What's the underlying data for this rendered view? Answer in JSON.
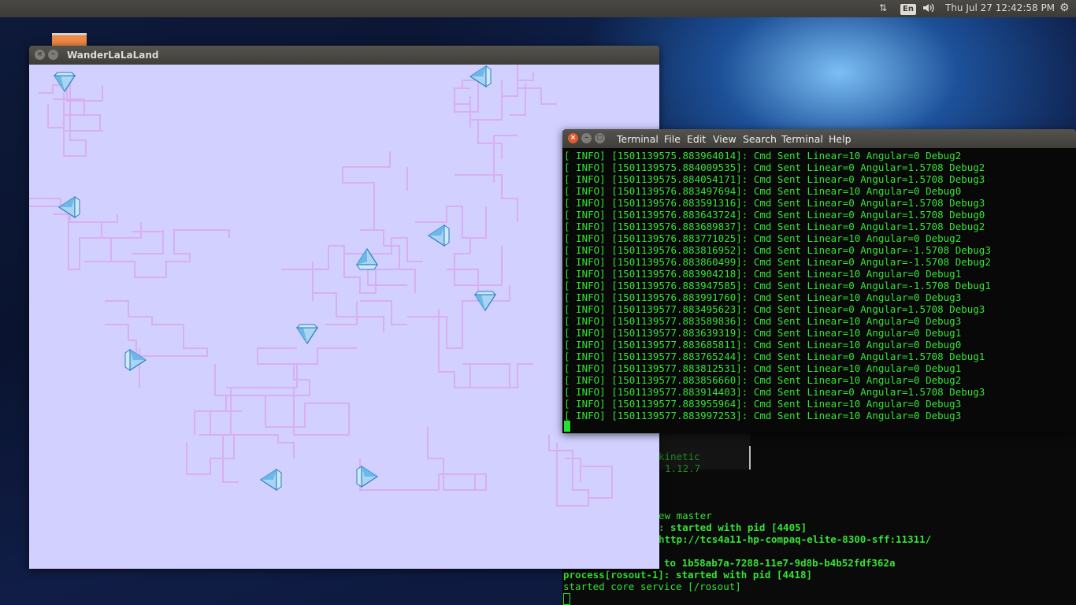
{
  "topbar": {
    "keyboard_layout": "En",
    "clock": "Thu Jul 27 12:42:58 PM",
    "icons": [
      "network-arrows-icon",
      "volume-icon",
      "settings-gear-icon"
    ]
  },
  "wander_window": {
    "title": "WanderLaLaLand",
    "trail_color": "#d9aef2",
    "canvas_color": "#d1d0ff",
    "robot_icon": "blue-diamond-robot-icon"
  },
  "terminal": {
    "menu": [
      "Terminal",
      "File",
      "Edit",
      "View",
      "Search",
      "Terminal",
      "Help"
    ],
    "lines": [
      "[ INFO] [1501139575.883964014]: Cmd Sent Linear=10 Angular=0 Debug2",
      "[ INFO] [1501139575.884009535]: Cmd Sent Linear=0 Angular=1.5708 Debug2",
      "[ INFO] [1501139575.884054171]: Cmd Sent Linear=0 Angular=1.5708 Debug3",
      "[ INFO] [1501139576.883497694]: Cmd Sent Linear=10 Angular=0 Debug0",
      "[ INFO] [1501139576.883591316]: Cmd Sent Linear=0 Angular=1.5708 Debug3",
      "[ INFO] [1501139576.883643724]: Cmd Sent Linear=0 Angular=1.5708 Debug0",
      "[ INFO] [1501139576.883689837]: Cmd Sent Linear=0 Angular=1.5708 Debug2",
      "[ INFO] [1501139576.883771025]: Cmd Sent Linear=10 Angular=0 Debug2",
      "[ INFO] [1501139576.883816952]: Cmd Sent Linear=0 Angular=-1.5708 Debug3",
      "[ INFO] [1501139576.883860499]: Cmd Sent Linear=0 Angular=-1.5708 Debug2",
      "[ INFO] [1501139576.883904218]: Cmd Sent Linear=10 Angular=0 Debug1",
      "[ INFO] [1501139576.883947585]: Cmd Sent Linear=0 Angular=-1.5708 Debug1",
      "[ INFO] [1501139576.883991760]: Cmd Sent Linear=10 Angular=0 Debug3",
      "[ INFO] [1501139577.883495623]: Cmd Sent Linear=0 Angular=1.5708 Debug3",
      "[ INFO] [1501139577.883589836]: Cmd Sent Linear=10 Angular=0 Debug3",
      "[ INFO] [1501139577.883639319]: Cmd Sent Linear=10 Angular=0 Debug1",
      "[ INFO] [1501139577.883685811]: Cmd Sent Linear=10 Angular=0 Debug0",
      "[ INFO] [1501139577.883765244]: Cmd Sent Linear=0 Angular=1.5708 Debug1",
      "[ INFO] [1501139577.883812531]: Cmd Sent Linear=10 Angular=0 Debug1",
      "[ INFO] [1501139577.883856660]: Cmd Sent Linear=10 Angular=0 Debug2",
      "[ INFO] [1501139577.883914403]: Cmd Sent Linear=0 Angular=1.5708 Debug3",
      "[ INFO] [1501139577.883955964]: Cmd Sent Linear=10 Angular=0 Debug3",
      "[ INFO] [1501139577.883997253]: Cmd Sent Linear=10 Angular=0 Debug3"
    ]
  },
  "background_terminal": {
    "lines": [
      "kinetic",
      "1.12.7",
      "ew master",
      ": started with pid [4405]",
      "http://tcs4a11-hp-compaq-elite-8300-sff:11311/",
      "to 1b58ab7a-7288-11e7-9d8b-b4b52fdf362a",
      "process[rosout-1]: started with pid [4418]",
      "started core service [/rosout]"
    ]
  }
}
